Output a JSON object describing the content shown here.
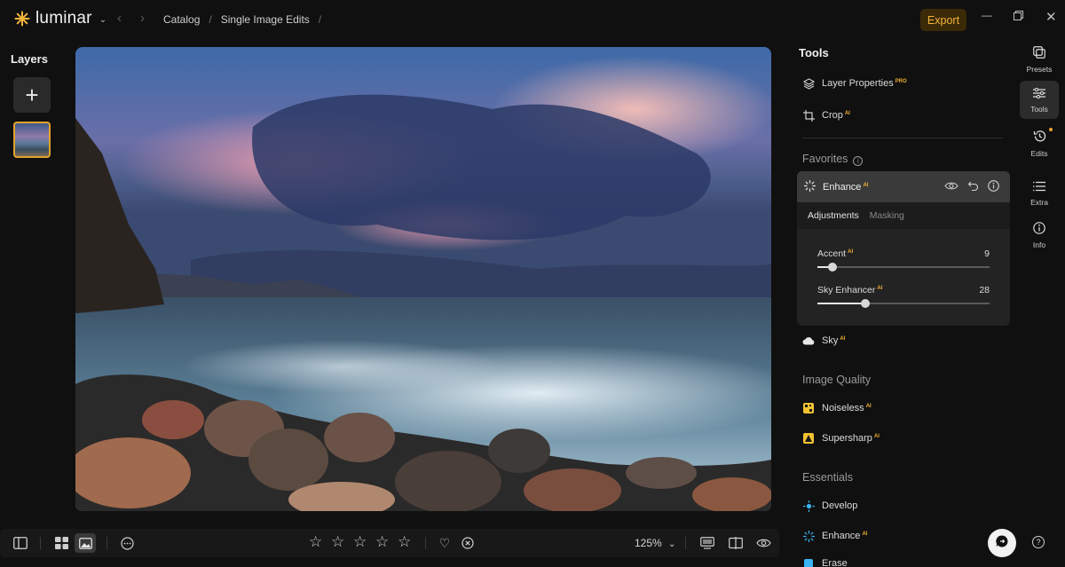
{
  "app": {
    "name": "luminar"
  },
  "breadcrumb": [
    "Catalog",
    "Single Image Edits"
  ],
  "topbar": {
    "export_label": "Export"
  },
  "layers": {
    "title": "Layers"
  },
  "tools": {
    "title": "Tools",
    "items": [
      {
        "label": "Layer Properties",
        "badge": "PRO",
        "icon": "layers-icon"
      },
      {
        "label": "Crop",
        "badge": "AI",
        "icon": "crop-icon"
      }
    ]
  },
  "favorites": {
    "title": "Favorites",
    "enhance": {
      "label": "Enhance",
      "badge": "AI",
      "tabs": [
        "Adjustments",
        "Masking"
      ],
      "sliders": [
        {
          "label": "Accent",
          "badge": "AI",
          "value": 9,
          "min": 0,
          "max": 100
        },
        {
          "label": "Sky Enhancer",
          "badge": "AI",
          "value": 28,
          "min": 0,
          "max": 100
        }
      ]
    },
    "sky": {
      "label": "Sky",
      "badge": "AI"
    }
  },
  "image_quality": {
    "title": "Image Quality",
    "items": [
      {
        "label": "Noiseless",
        "badge": "AI",
        "icon": "noiseless-icon"
      },
      {
        "label": "Supersharp",
        "badge": "AI",
        "icon": "supersharp-icon"
      }
    ]
  },
  "essentials": {
    "title": "Essentials",
    "items": [
      {
        "label": "Develop",
        "icon": "develop-icon"
      },
      {
        "label": "Enhance",
        "badge": "AI",
        "icon": "enhance-icon"
      },
      {
        "label": "Erase",
        "icon": "erase-icon"
      }
    ]
  },
  "right_nav": [
    {
      "label": "Presets",
      "icon": "presets-icon"
    },
    {
      "label": "Tools",
      "icon": "tools-icon",
      "active": true
    },
    {
      "label": "Edits",
      "icon": "history-icon"
    },
    {
      "label": "Extra",
      "icon": "extra-icon"
    },
    {
      "label": "Info",
      "icon": "info-icon"
    }
  ],
  "bottom": {
    "zoom": "125%",
    "rating_stars": 5,
    "rating_value": 0
  },
  "colors": {
    "accent": "#f4b43a",
    "export_bg": "#3a2a08",
    "panel_bg": "#101010"
  }
}
